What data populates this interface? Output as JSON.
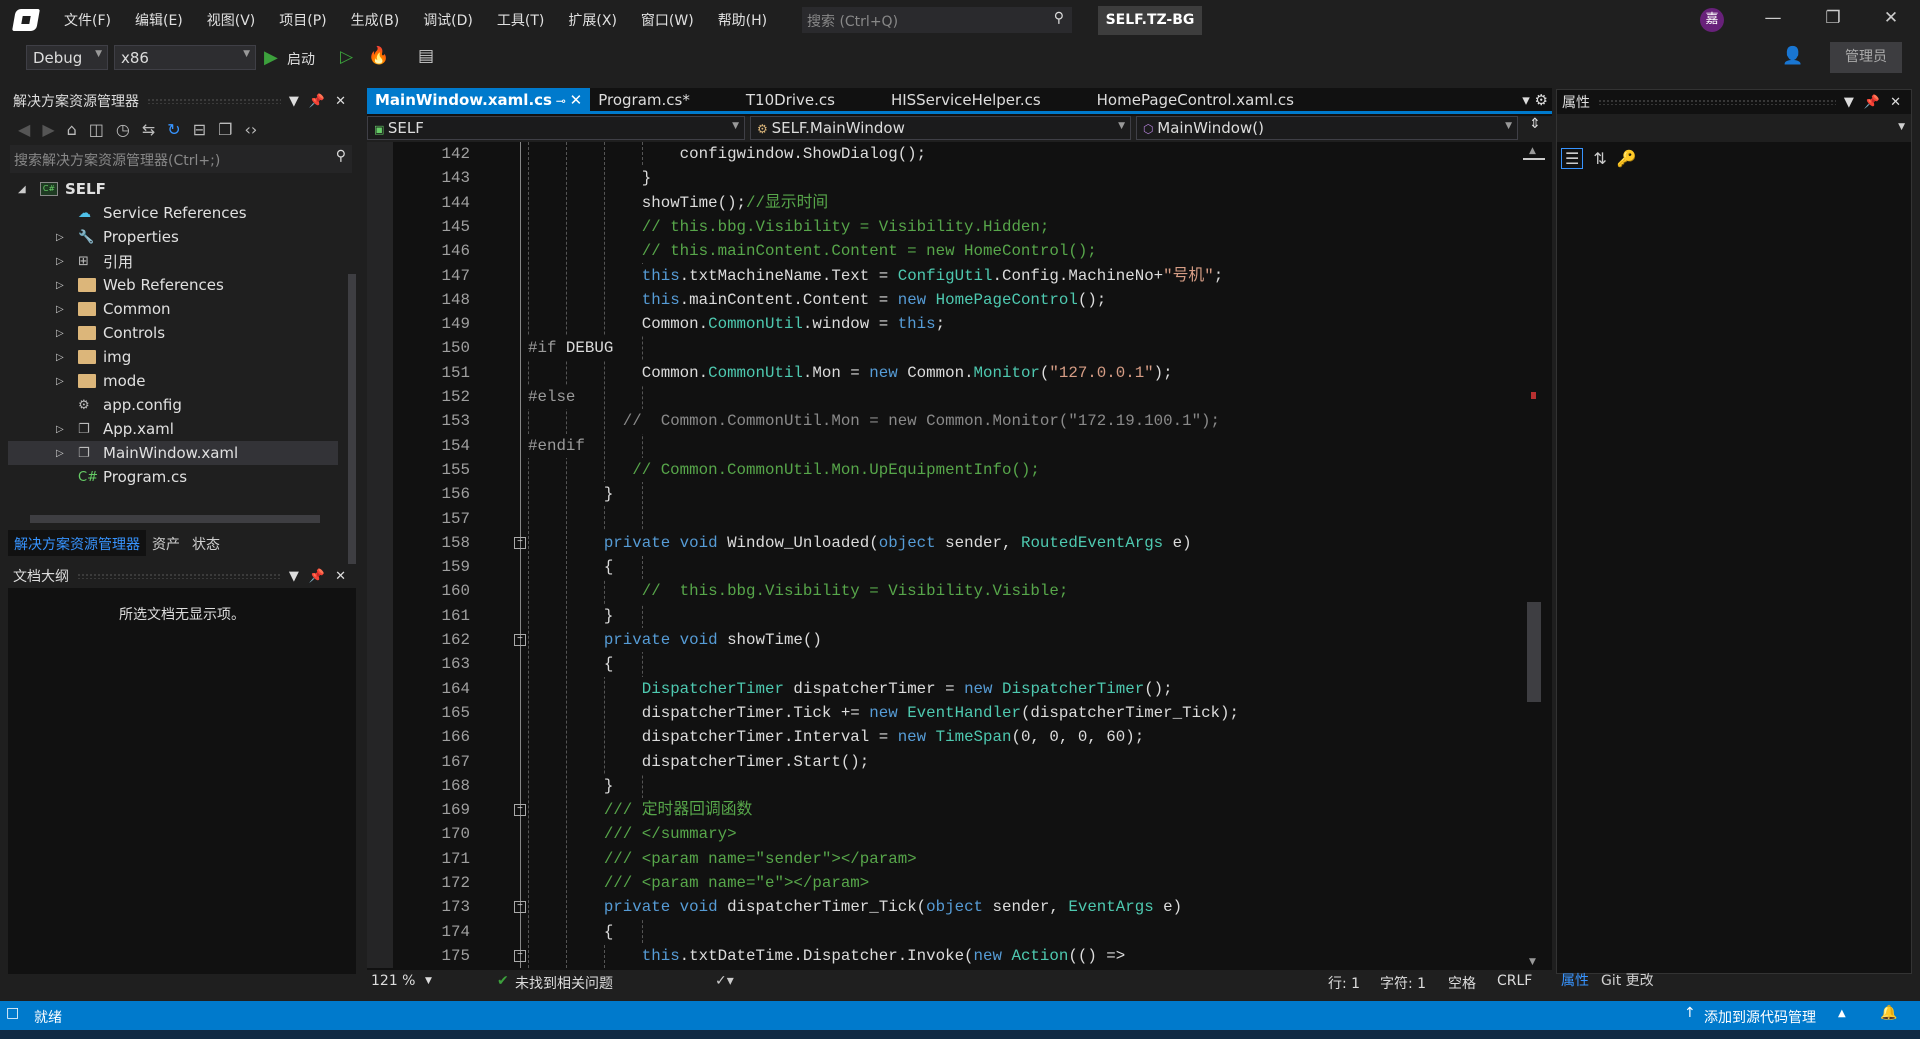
{
  "titlebar": {
    "menu": [
      "文件(F)",
      "编辑(E)",
      "视图(V)",
      "项目(P)",
      "生成(B)",
      "调试(D)",
      "工具(T)",
      "扩展(X)",
      "窗口(W)",
      "帮助(H)"
    ],
    "search_placeholder": "搜索 (Ctrl+Q)",
    "solution_name": "SELF.TZ-BG",
    "avatar_initial": "嘉"
  },
  "toolbar": {
    "config": "Debug",
    "platform": "x86",
    "start_label": "启动",
    "admin_label": "管理员"
  },
  "solution_explorer": {
    "title": "解决方案资源管理器",
    "search_placeholder": "搜索解决方案资源管理器(Ctrl+;)",
    "items": [
      {
        "label": "SELF",
        "level": 0,
        "expander": "expanded",
        "icon": "csharp-project-icon",
        "bold": true
      },
      {
        "label": "Service References",
        "level": 1,
        "expander": "none",
        "icon": "service-reference-icon"
      },
      {
        "label": "Properties",
        "level": 1,
        "expander": "collapsed",
        "icon": "wrench-icon"
      },
      {
        "label": "引用",
        "level": 1,
        "expander": "collapsed",
        "icon": "references-icon"
      },
      {
        "label": "Web References",
        "level": 1,
        "expander": "collapsed",
        "icon": "folder-icon"
      },
      {
        "label": "Common",
        "level": 1,
        "expander": "collapsed",
        "icon": "folder-icon"
      },
      {
        "label": "Controls",
        "level": 1,
        "expander": "collapsed",
        "icon": "folder-icon"
      },
      {
        "label": "img",
        "level": 1,
        "expander": "collapsed",
        "icon": "folder-icon"
      },
      {
        "label": "mode",
        "level": 1,
        "expander": "collapsed",
        "icon": "folder-icon"
      },
      {
        "label": "app.config",
        "level": 1,
        "expander": "none",
        "icon": "config-file-icon"
      },
      {
        "label": "App.xaml",
        "level": 1,
        "expander": "collapsed",
        "icon": "xaml-file-icon"
      },
      {
        "label": "MainWindow.xaml",
        "level": 1,
        "expander": "collapsed",
        "icon": "xaml-file-icon",
        "selected": true
      },
      {
        "label": "Program.cs",
        "level": 1,
        "expander": "none",
        "icon": "csharp-file-icon"
      }
    ],
    "bottom_tabs": [
      "解决方案资源管理器",
      "资产",
      "状态"
    ]
  },
  "outline": {
    "title": "文档大纲",
    "empty_text": "所选文档无显示项。"
  },
  "editor": {
    "tabs": [
      {
        "label": "MainWindow.xaml.cs",
        "active": true
      },
      {
        "label": "Program.cs*"
      },
      {
        "label": "T10Drive.cs"
      },
      {
        "label": "HISServiceHelper.cs"
      },
      {
        "label": "HomePageControl.xaml.cs"
      }
    ],
    "nav": {
      "project": "SELF",
      "type": "SELF.MainWindow",
      "member": "MainWindow()"
    },
    "lines": [
      {
        "n": 142,
        "i": 16,
        "tk": [
          [
            "p",
            "configwindow.ShowDialog();"
          ]
        ]
      },
      {
        "n": 143,
        "i": 12,
        "tk": [
          [
            "p",
            "}"
          ]
        ]
      },
      {
        "n": 144,
        "i": 12,
        "tk": [
          [
            "p",
            "showTime();"
          ],
          [
            "c",
            "//显示时间"
          ]
        ]
      },
      {
        "n": 145,
        "i": 12,
        "tk": [
          [
            "c",
            "// this.bbg.Visibility = Visibility.Hidden;"
          ]
        ]
      },
      {
        "n": 146,
        "i": 12,
        "tk": [
          [
            "c",
            "// this.mainContent.Content = new HomeControl();"
          ]
        ]
      },
      {
        "n": 147,
        "i": 12,
        "tk": [
          [
            "k",
            "this"
          ],
          [
            "p",
            ".txtMachineName.Text = "
          ],
          [
            "t",
            "ConfigUtil"
          ],
          [
            "p",
            ".Config.MachineNo+"
          ],
          [
            "s",
            "\"号机\""
          ],
          [
            "p",
            ";"
          ]
        ]
      },
      {
        "n": 148,
        "i": 12,
        "tk": [
          [
            "k",
            "this"
          ],
          [
            "p",
            ".mainContent.Content = "
          ],
          [
            "k",
            "new "
          ],
          [
            "t",
            "HomePageControl"
          ],
          [
            "p",
            "();"
          ]
        ]
      },
      {
        "n": 149,
        "i": 12,
        "tk": [
          [
            "p",
            "Common."
          ],
          [
            "t",
            "CommonUtil"
          ],
          [
            "p",
            ".window = "
          ],
          [
            "k",
            "this"
          ],
          [
            "p",
            ";"
          ]
        ]
      },
      {
        "n": 150,
        "i": 0,
        "tk": [
          [
            "pp",
            "#if "
          ],
          [
            "p",
            "DEBUG"
          ]
        ]
      },
      {
        "n": 151,
        "i": 12,
        "tk": [
          [
            "p",
            "Common."
          ],
          [
            "t",
            "CommonUtil"
          ],
          [
            "p",
            ".Mon = "
          ],
          [
            "k",
            "new "
          ],
          [
            "p",
            "Common."
          ],
          [
            "t",
            "Monitor"
          ],
          [
            "p",
            "("
          ],
          [
            "s",
            "\"127.0.0.1\""
          ],
          [
            "p",
            ");"
          ]
        ]
      },
      {
        "n": 152,
        "i": 0,
        "tk": [
          [
            "pp",
            "#else"
          ]
        ]
      },
      {
        "n": 153,
        "i": 10,
        "tk": [
          [
            "g",
            "//  Common.CommonUtil.Mon = new Common.Monitor(\"172.19.100.1\");"
          ]
        ]
      },
      {
        "n": 154,
        "i": 0,
        "tk": [
          [
            "pp",
            "#endif"
          ]
        ]
      },
      {
        "n": 155,
        "i": 11,
        "tk": [
          [
            "c",
            "// Common.CommonUtil.Mon.UpEquipmentInfo();"
          ]
        ]
      },
      {
        "n": 156,
        "i": 8,
        "tk": [
          [
            "p",
            "}"
          ]
        ]
      },
      {
        "n": 157,
        "i": 0,
        "tk": []
      },
      {
        "n": 158,
        "i": 8,
        "fold": true,
        "tk": [
          [
            "k",
            "private void "
          ],
          [
            "p",
            "Window_Unloaded("
          ],
          [
            "k",
            "object "
          ],
          [
            "p",
            "sender, "
          ],
          [
            "t",
            "RoutedEventArgs"
          ],
          [
            "p",
            " e)"
          ]
        ]
      },
      {
        "n": 159,
        "i": 8,
        "tk": [
          [
            "p",
            "{"
          ]
        ]
      },
      {
        "n": 160,
        "i": 12,
        "tk": [
          [
            "c",
            "//  this.bbg.Visibility = Visibility.Visible;"
          ]
        ]
      },
      {
        "n": 161,
        "i": 8,
        "tk": [
          [
            "p",
            "}"
          ]
        ]
      },
      {
        "n": 162,
        "i": 8,
        "fold": true,
        "tk": [
          [
            "k",
            "private void "
          ],
          [
            "p",
            "showTime()"
          ]
        ]
      },
      {
        "n": 163,
        "i": 8,
        "tk": [
          [
            "p",
            "{"
          ]
        ]
      },
      {
        "n": 164,
        "i": 12,
        "tk": [
          [
            "t",
            "DispatcherTimer"
          ],
          [
            "p",
            " dispatcherTimer = "
          ],
          [
            "k",
            "new "
          ],
          [
            "t",
            "DispatcherTimer"
          ],
          [
            "p",
            "();"
          ]
        ]
      },
      {
        "n": 165,
        "i": 12,
        "tk": [
          [
            "p",
            "dispatcherTimer.Tick += "
          ],
          [
            "k",
            "new "
          ],
          [
            "t",
            "EventHandler"
          ],
          [
            "p",
            "(dispatcherTimer_Tick);"
          ]
        ]
      },
      {
        "n": 166,
        "i": 12,
        "tk": [
          [
            "p",
            "dispatcherTimer.Interval = "
          ],
          [
            "k",
            "new "
          ],
          [
            "t",
            "TimeSpan"
          ],
          [
            "p",
            "(0, 0, 0, 60);"
          ]
        ]
      },
      {
        "n": 167,
        "i": 12,
        "tk": [
          [
            "p",
            "dispatcherTimer.Start();"
          ]
        ]
      },
      {
        "n": 168,
        "i": 8,
        "tk": [
          [
            "p",
            "}"
          ]
        ]
      },
      {
        "n": 169,
        "i": 8,
        "fold": true,
        "tk": [
          [
            "c",
            "/// 定时器回调函数"
          ]
        ]
      },
      {
        "n": 170,
        "i": 8,
        "tk": [
          [
            "c",
            "/// </summary>"
          ]
        ]
      },
      {
        "n": 171,
        "i": 8,
        "tk": [
          [
            "c",
            "/// <param name=\"sender\"></param>"
          ]
        ]
      },
      {
        "n": 172,
        "i": 8,
        "tk": [
          [
            "c",
            "/// <param name=\"e\"></param>"
          ]
        ]
      },
      {
        "n": 173,
        "i": 8,
        "fold": true,
        "tk": [
          [
            "k",
            "private void "
          ],
          [
            "p",
            "dispatcherTimer_Tick("
          ],
          [
            "k",
            "object "
          ],
          [
            "p",
            "sender, "
          ],
          [
            "t",
            "EventArgs"
          ],
          [
            "p",
            " e)"
          ]
        ]
      },
      {
        "n": 174,
        "i": 8,
        "tk": [
          [
            "p",
            "{"
          ]
        ]
      },
      {
        "n": 175,
        "i": 12,
        "fold": true,
        "tk": [
          [
            "k",
            "this"
          ],
          [
            "p",
            ".txtDateTime.Dispatcher.Invoke("
          ],
          [
            "k",
            "new "
          ],
          [
            "t",
            "Action"
          ],
          [
            "p",
            "(() =>"
          ]
        ]
      }
    ],
    "status": {
      "zoom": "121 %",
      "issues": "未找到相关问题",
      "line": "行: 1",
      "char": "字符: 1",
      "spaces": "空格",
      "eol": "CRLF"
    }
  },
  "properties": {
    "title": "属性",
    "bottom_tabs": [
      "属性",
      "Git 更改"
    ]
  },
  "statusbar": {
    "ready": "就绪",
    "source_control": "添加到源代码管理"
  },
  "colors": {
    "accent": "#007acc",
    "keyword": "#569cd6",
    "type": "#4ec9b0",
    "comment": "#57a64a",
    "string": "#d69d85"
  }
}
